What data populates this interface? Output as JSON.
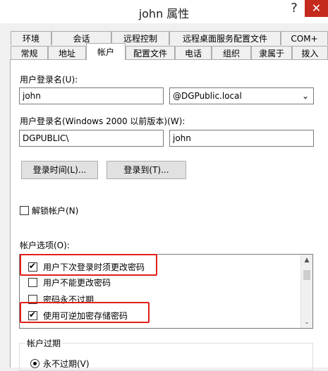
{
  "window": {
    "title": "john 属性",
    "help": "?",
    "close": "✕"
  },
  "tabs_row1": [
    "环境",
    "会话",
    "远程控制",
    "远程桌面服务配置文件",
    "COM+"
  ],
  "tabs_row2": [
    "常规",
    "地址",
    "帐户",
    "配置文件",
    "电话",
    "组织",
    "隶属于",
    "拨入"
  ],
  "active_tab": "帐户",
  "account": {
    "logon_name_label": "用户登录名(U):",
    "logon_name_value": "john",
    "domain_value": "@DGPublic.local",
    "pre2000_label": "用户登录名(Windows 2000 以前版本)(W):",
    "pre2000_domain": "DGPUBLIC\\",
    "pre2000_name": "john",
    "logon_hours_button": "登录时间(L)...",
    "logon_to_button": "登录到(T)...",
    "unlock_label": "解锁帐户(N)",
    "options_label": "帐户选项(O):",
    "options": [
      {
        "label": "用户下次登录时须更改密码",
        "checked": true
      },
      {
        "label": "用户不能更改密码",
        "checked": false
      },
      {
        "label": "密码永不过期",
        "checked": false
      },
      {
        "label": "使用可逆加密存储密码",
        "checked": true
      }
    ],
    "expire_group_label": "帐户过期",
    "never_expire_label": "永不过期(V)"
  },
  "colors": {
    "highlight": "#e3201b",
    "close_bg": "#c42b1c"
  }
}
